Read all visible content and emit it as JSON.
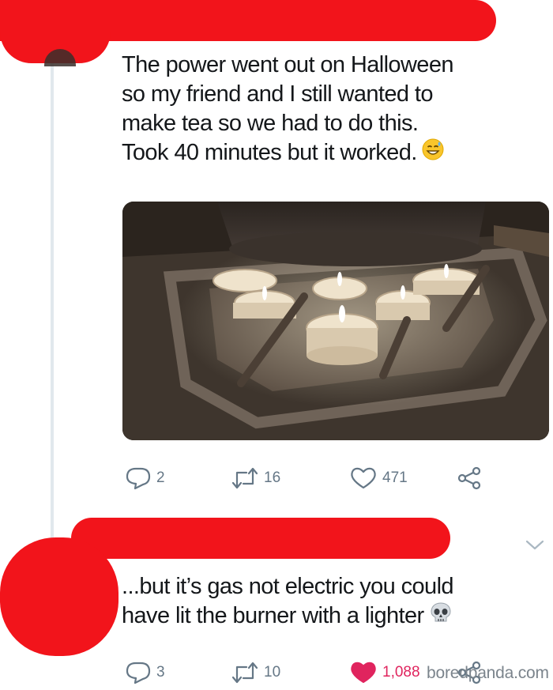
{
  "tweet1": {
    "text_lines": [
      "The power went out on Halloween",
      "so my friend and I still wanted to",
      "make tea so we had to do this.",
      "Took 40 minutes but it worked."
    ],
    "emoji": "grinning-sweat-emoji",
    "reply_count": "2",
    "retweet_count": "16",
    "like_count": "471"
  },
  "tweet2": {
    "text_lines": [
      "...but it’s gas not electric you could",
      "have lit the burner with a lighter"
    ],
    "emoji": "skull-emoji",
    "reply_count": "3",
    "retweet_count": "10",
    "like_count": "1,088"
  },
  "watermark": "boredpanda.com",
  "colors": {
    "redaction": "#f2141b",
    "text": "#14171a",
    "icon_gray": "#657786",
    "liked_red": "#e0245e",
    "thread_line": "#e1e8ed"
  },
  "icons": [
    "reply-icon",
    "retweet-icon",
    "like-icon",
    "share-icon",
    "chevron-down-icon"
  ]
}
